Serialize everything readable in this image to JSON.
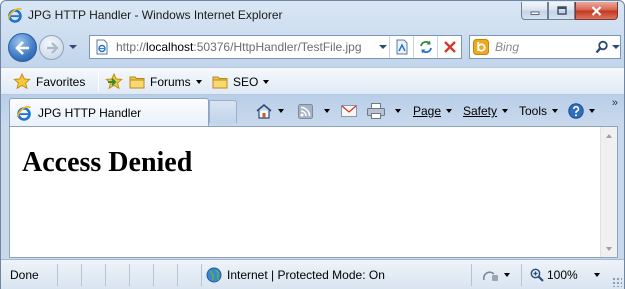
{
  "window": {
    "title": "JPG HTTP Handler - Windows Internet Explorer"
  },
  "address_bar": {
    "url_prefix": "http://",
    "url_host": "localhost",
    "url_rest": ":50376/HttpHandler/TestFile.jpg"
  },
  "search": {
    "placeholder": "Bing"
  },
  "favorites_bar": {
    "favorites_label": "Favorites",
    "items": [
      {
        "label": "Forums"
      },
      {
        "label": "SEO"
      }
    ]
  },
  "tab": {
    "label": "JPG HTTP Handler"
  },
  "command_bar": {
    "page_label": "Page",
    "safety_label": "Safety",
    "tools_label": "Tools",
    "overflow": "»"
  },
  "page": {
    "heading": "Access Denied"
  },
  "status_bar": {
    "status": "Done",
    "zone": "Internet | Protected Mode: On",
    "zoom": "100%"
  },
  "colors": {
    "accent": "#3e78c4",
    "close_button": "#c2351f",
    "frame": "#b9cfe8"
  }
}
